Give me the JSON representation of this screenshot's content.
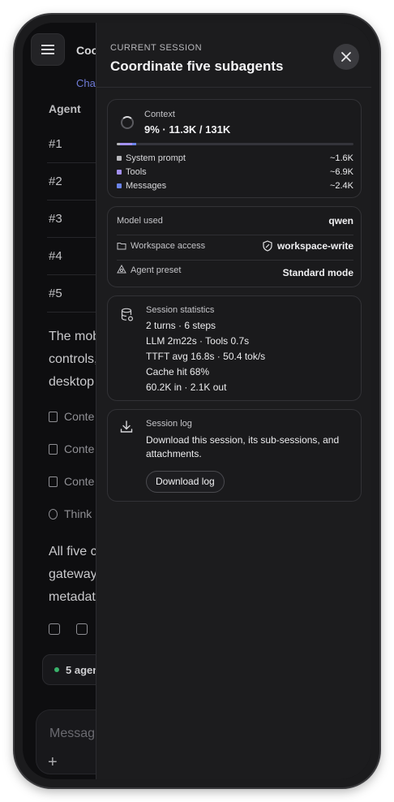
{
  "background": {
    "app_title": "Coo",
    "tab": "Chat",
    "table_header": "Agent",
    "rows": [
      "#1",
      "#2",
      "#3",
      "#4",
      "#5"
    ],
    "paragraph1": [
      "The mob",
      "controls,",
      "desktop"
    ],
    "chips": [
      "Conte",
      "Conte",
      "Conte",
      "Think"
    ],
    "paragraph2": [
      "All five c",
      "gateway",
      "metadat"
    ],
    "agents_chip": "5 agen",
    "composer_placeholder": "Messag"
  },
  "drawer": {
    "eyebrow": "CURRENT SESSION",
    "title": "Coordinate five subagents",
    "context": {
      "label": "Context",
      "value": "9% · 11.3K / 131K",
      "segments": [
        {
          "name": "System prompt",
          "value": "~1.6K",
          "tokens": 1.6,
          "color": "#b9b9bd"
        },
        {
          "name": "Tools",
          "value": "~6.9K",
          "tokens": 6.9,
          "color": "#a390f0"
        },
        {
          "name": "Messages",
          "value": "~2.4K",
          "tokens": 2.4,
          "color": "#6b84ea"
        }
      ],
      "total_tokens": 131
    },
    "model": {
      "model_label": "Model used",
      "model_value": "qwen",
      "workspace_label": "Workspace access",
      "workspace_value": "workspace-write",
      "preset_label": "Agent preset",
      "preset_value": "Standard mode"
    },
    "stats": {
      "label": "Session statistics",
      "lines": [
        "2 turns · 6 steps",
        "LLM 2m22s · Tools 0.7s",
        "TTFT avg 16.8s · 50.4 tok/s",
        "Cache hit 68%",
        "60.2K in · 2.1K out"
      ]
    },
    "log": {
      "label": "Session log",
      "description": "Download this session, its sub-sessions, and attachments.",
      "button": "Download log"
    }
  }
}
